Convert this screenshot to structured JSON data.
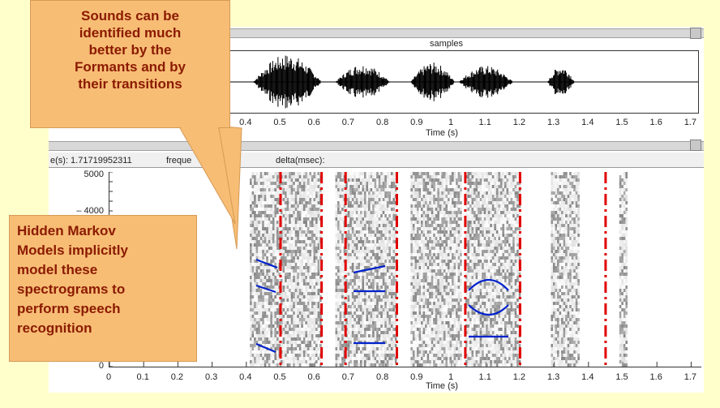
{
  "callout_top": {
    "lines": [
      "Sounds can be",
      "identified much",
      "better by the",
      "Formants and by",
      "their transitions"
    ]
  },
  "callout_left": {
    "lines": [
      "Hidden Markov",
      "Models implicitly",
      "model these",
      "spectrograms to",
      "perform speech",
      "recognition"
    ]
  },
  "waveform": {
    "title": "samples",
    "xlabel": "Time (s)",
    "visible_ticks": [
      "0.4",
      "0.5",
      "0.6",
      "0.7",
      "0.8",
      "0.9",
      "1",
      "1.1",
      "1.2",
      "1.3",
      "1.4",
      "1.5",
      "1.6",
      "1.7"
    ]
  },
  "spectrogram": {
    "status": {
      "time_label": "e(s): 1.71719952311",
      "freq_label": "freque",
      "zero": "0",
      "delta_label": "delta(msec):"
    },
    "ytick_top": "5000",
    "ytick_partial": "– 4000",
    "ytick_bottom": "0",
    "xlabel": "Time (s)",
    "xticks": [
      "0",
      "0.1",
      "0.2",
      "0.3",
      "0.4",
      "0.5",
      "0.6",
      "0.7",
      "0.8",
      "0.9",
      "1",
      "1.1",
      "1.2",
      "1.3",
      "1.4",
      "1.5",
      "1.6",
      "1.7"
    ],
    "boundary_times": [
      0.5,
      0.62,
      0.69,
      0.84,
      1.04,
      1.2,
      1.45
    ],
    "colors": {
      "boundary": "#e00000",
      "formant": "#0022cc",
      "callout_fill": "#f7bd75",
      "callout_text": "#8b1a00"
    }
  }
}
